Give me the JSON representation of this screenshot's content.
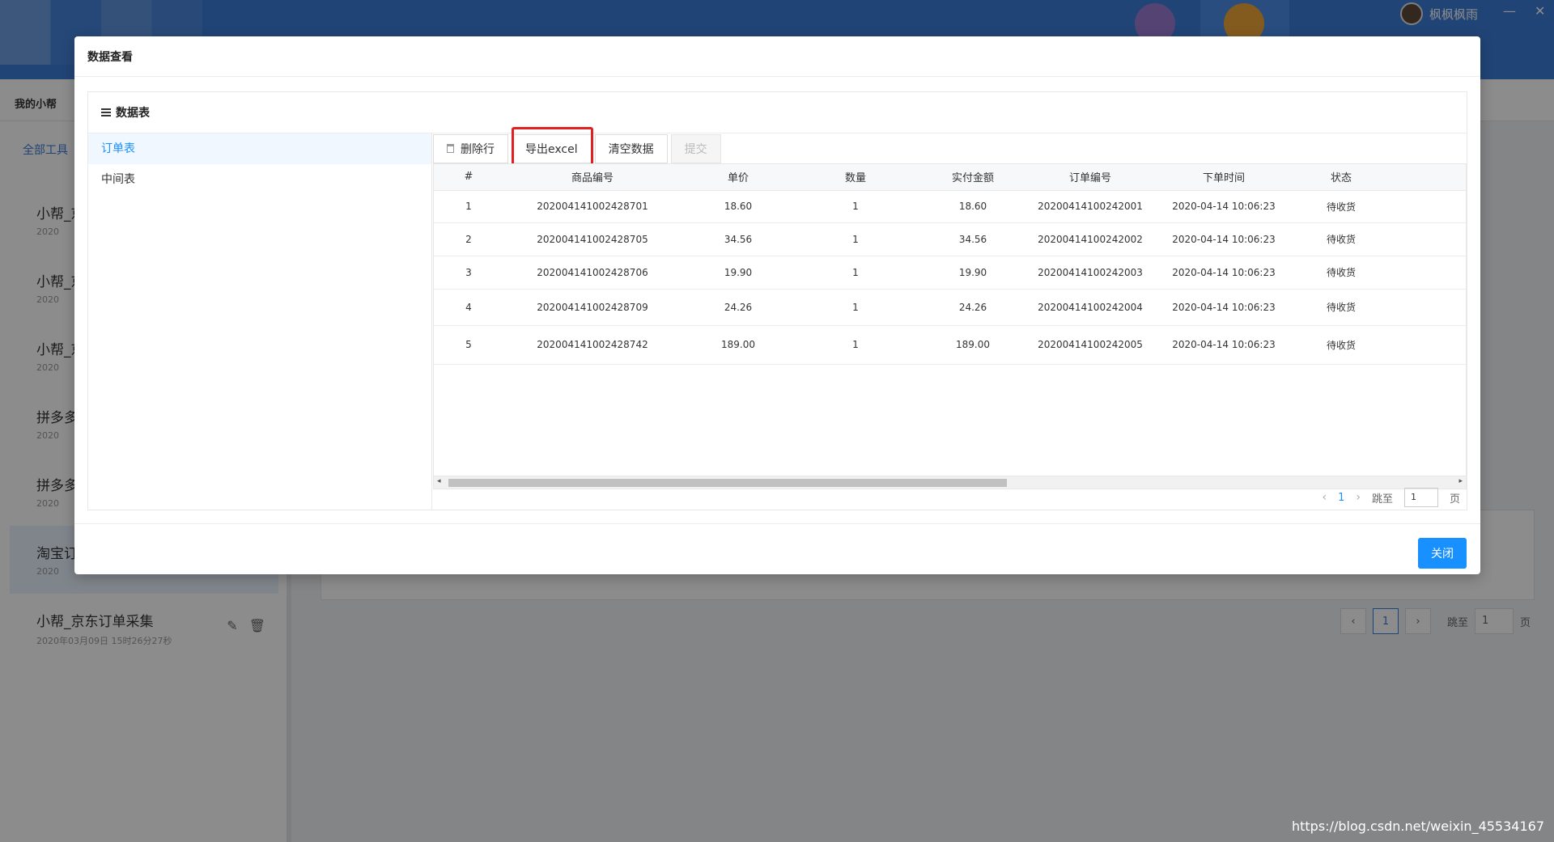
{
  "app": {
    "username": "枫枫枫雨",
    "minimize": "—",
    "close": "✕",
    "sub_title": "我的小帮",
    "all_tools": "全部工具"
  },
  "bg_list": [
    {
      "title": "小帮_京",
      "date": "2020"
    },
    {
      "title": "小帮_京",
      "date": "2020"
    },
    {
      "title": "小帮_京",
      "date": "2020"
    },
    {
      "title": "拼多多",
      "date": "2020"
    },
    {
      "title": "拼多多",
      "date": "2020"
    },
    {
      "title": "淘宝订",
      "date": "2020"
    },
    {
      "title": "小帮_京东订单采集",
      "date": "2020年03月09日 15时26分27秒"
    }
  ],
  "bg_pager": {
    "prev": "‹",
    "page": "1",
    "next": "›",
    "jump": "跳至",
    "input": "1",
    "unit": "页"
  },
  "modal": {
    "title": "数据查看",
    "panel_title": "数据表",
    "tables": [
      "订单表",
      "中间表"
    ],
    "toolbar": {
      "delete": "删除行",
      "export": "导出excel",
      "clear": "清空数据",
      "submit": "提交"
    },
    "columns": [
      "#",
      "商品编号",
      "单价",
      "数量",
      "实付金额",
      "订单编号",
      "下单时间",
      "状态"
    ],
    "rows": [
      [
        "1",
        "202004141002428701",
        "18.60",
        "1",
        "18.60",
        "20200414100242001",
        "2020-04-14 10:06:23",
        "待收货"
      ],
      [
        "2",
        "202004141002428705",
        "34.56",
        "1",
        "34.56",
        "20200414100242002",
        "2020-04-14 10:06:23",
        "待收货"
      ],
      [
        "3",
        "202004141002428706",
        "19.90",
        "1",
        "19.90",
        "20200414100242003",
        "2020-04-14 10:06:23",
        "待收货"
      ],
      [
        "4",
        "202004141002428709",
        "24.26",
        "1",
        "24.26",
        "20200414100242004",
        "2020-04-14 10:06:23",
        "待收货"
      ],
      [
        "5",
        "202004141002428742",
        "189.00",
        "1",
        "189.00",
        "20200414100242005",
        "2020-04-14 10:06:23",
        "待收货"
      ]
    ],
    "pager": {
      "prev": "‹",
      "page": "1",
      "next": "›",
      "jump": "跳至",
      "input": "1",
      "unit": "页"
    },
    "close": "关闭"
  },
  "watermark": "https://blog.csdn.net/weixin_45534167",
  "colors": {
    "primary": "#1890ff",
    "header": "#3c7dd8",
    "highlight": "#e12020"
  }
}
